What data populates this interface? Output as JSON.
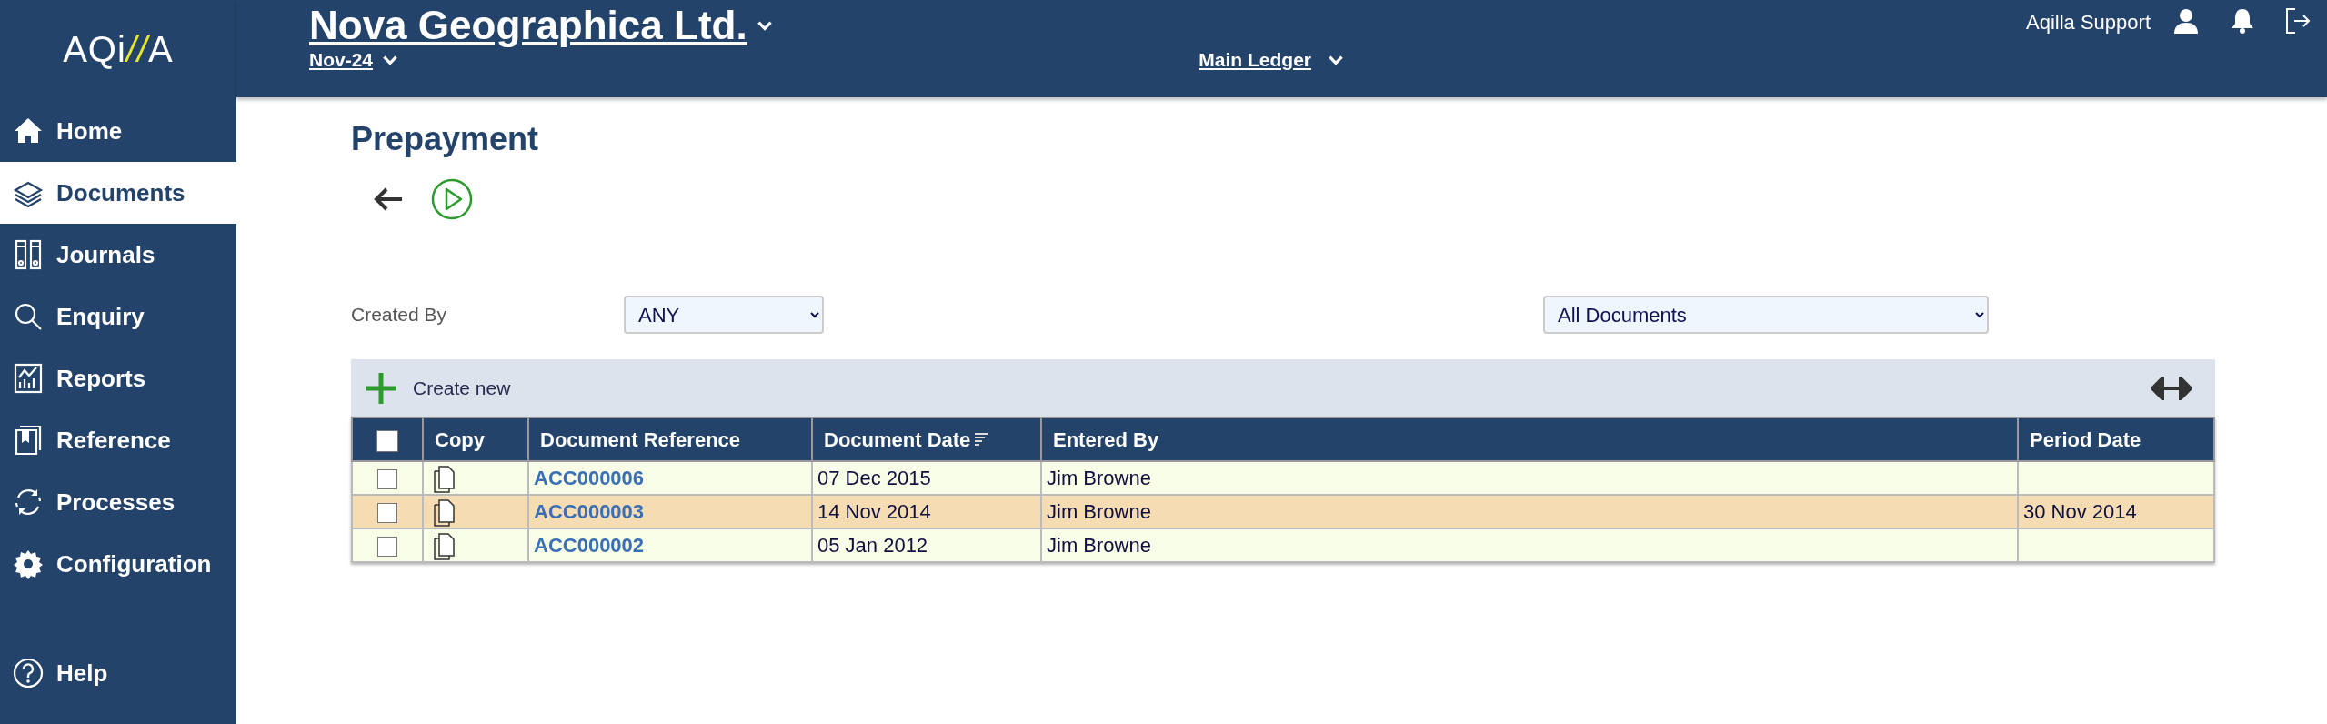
{
  "logo": [
    {
      "text": "AQi",
      "accent": false
    },
    {
      "text": "//",
      "accent": true
    },
    {
      "text": "A",
      "accent": false
    }
  ],
  "header": {
    "company": "Nova Geographica Ltd.",
    "period": "Nov-24",
    "ledger": "Main Ledger",
    "user": "Aqilla Support"
  },
  "sidebar": {
    "items": [
      {
        "label": "Home",
        "selected": false
      },
      {
        "label": "Documents",
        "selected": true
      },
      {
        "label": "Journals",
        "selected": false
      },
      {
        "label": "Enquiry",
        "selected": false
      },
      {
        "label": "Reports",
        "selected": false
      },
      {
        "label": "Reference",
        "selected": false
      },
      {
        "label": "Processes",
        "selected": false
      },
      {
        "label": "Configuration",
        "selected": false
      }
    ],
    "help": "Help"
  },
  "page_title": "Prepayment",
  "filters": {
    "created_by_label": "Created By",
    "created_by": "ANY",
    "document_filter": "All Documents"
  },
  "toolbar": {
    "create": "Create new"
  },
  "table": {
    "select_all_checked": false,
    "columns": [
      {
        "label": "Copy",
        "sorted": false
      },
      {
        "label": "Document Reference",
        "sorted": false
      },
      {
        "label": "Document Date",
        "sorted": true
      },
      {
        "label": "Entered By",
        "sorted": false
      },
      {
        "label": "Period Date",
        "sorted": false
      }
    ],
    "rows": [
      {
        "selected": false,
        "checked": false,
        "reference": "ACC000006",
        "document_date": "07 Dec 2015",
        "entered_by": "Jim Browne",
        "period_date": ""
      },
      {
        "selected": true,
        "checked": false,
        "reference": "ACC000003",
        "document_date": "14 Nov 2014",
        "entered_by": "Jim Browne",
        "period_date": "30 Nov 2014"
      },
      {
        "selected": false,
        "checked": false,
        "reference": "ACC000002",
        "document_date": "05 Jan 2012",
        "entered_by": "Jim Browne",
        "period_date": ""
      }
    ]
  }
}
